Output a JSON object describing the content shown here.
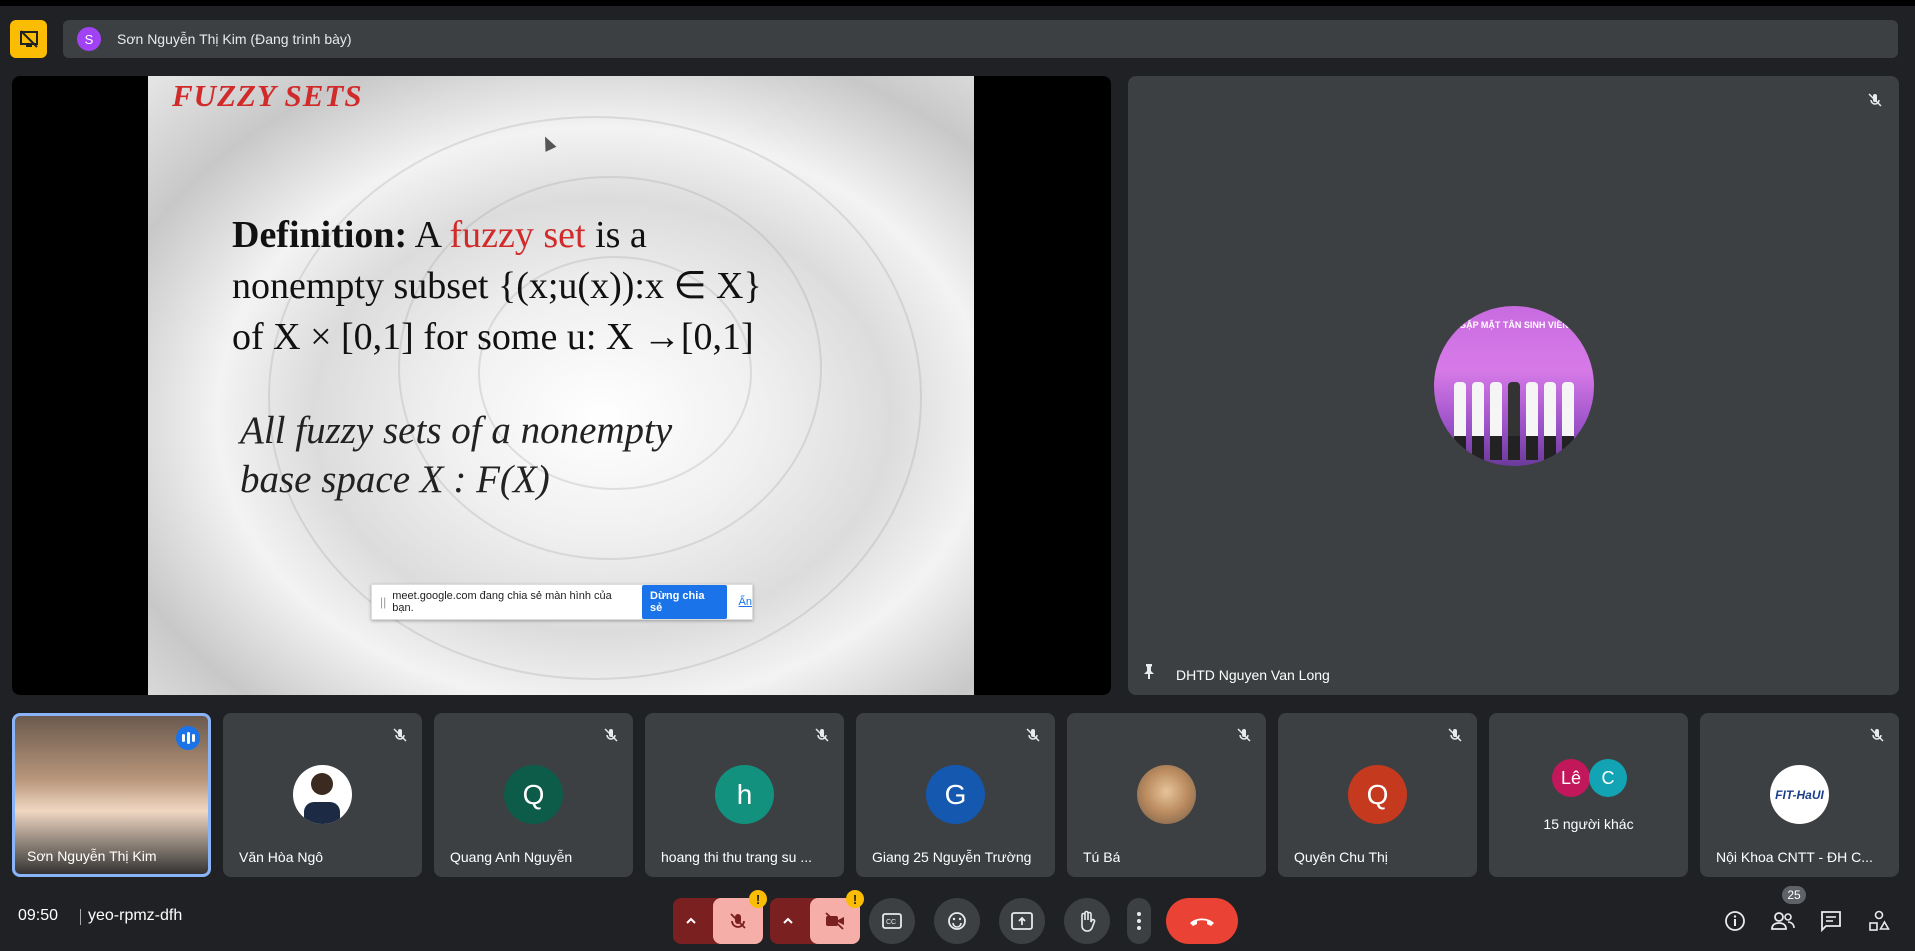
{
  "presenter": {
    "avatar_letter": "S",
    "label": "Sơn Nguyễn Thị Kim (Đang trình bày)"
  },
  "slide": {
    "title": "FUZZY SETS",
    "def_bold": "Definition:",
    "def_a": " A ",
    "def_red": "fuzzy set",
    "def_rest1": " is a",
    "line2": "nonempty subset {(x;u(x)):x ∈ X}",
    "line3": "of X × [0,1] for some u:  X →[0,1]",
    "all1": "All fuzzy sets of a nonempty",
    "all2": "base space X : F(X)"
  },
  "share_bar": {
    "text": "meet.google.com đang chia sẻ màn hình của bạn.",
    "stop_label": "Dừng chia sẻ",
    "hide_label": "Ẩn"
  },
  "main_tile": {
    "name": "DHTD Nguyen Van Long",
    "avatar_text": "GẶP MẶT TÂN SINH VIÊN"
  },
  "participants": [
    {
      "name": "Sơn Nguyễn Thị Kim"
    },
    {
      "name": "Văn Hòa Ngô"
    },
    {
      "name": "Quang Anh Nguyễn",
      "letter": "Q",
      "color": "#0d5c4a"
    },
    {
      "name": "hoang thi thu trang su ...",
      "letter": "h",
      "color": "#12927e"
    },
    {
      "name": "Giang 25 Nguyễn Trường",
      "letter": "G",
      "color": "#1558b0"
    },
    {
      "name": "Tú Bá"
    },
    {
      "name": "Quyên Chu Thị",
      "letter": "Q",
      "color": "#c5391f"
    },
    {
      "name": "Nội Khoa CNTT - ĐH C...",
      "logo_text": "FIT-HaUI"
    }
  ],
  "others": {
    "letter1": "Lê",
    "letter2": "C",
    "label": "15 người khác"
  },
  "bottom": {
    "time": "09:50",
    "meeting_code": "yeo-rpmz-dfh",
    "participant_count": "25"
  }
}
